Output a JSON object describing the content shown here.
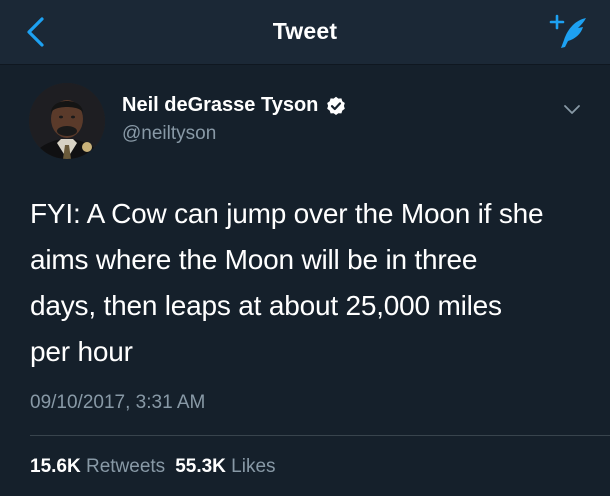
{
  "nav": {
    "title": "Tweet",
    "back_icon": "chevron-left-icon",
    "compose_icon": "compose-tweet-icon",
    "accent_color": "#1da1f2"
  },
  "tweet": {
    "author_name": "Neil deGrasse Tyson",
    "handle": "@neiltyson",
    "verified": true,
    "text": "FYI: A Cow can jump over the Moon if she\naims where the Moon will be in three\ndays, then leaps at about 25,000 miles\nper hour",
    "timestamp": "09/10/2017, 3:31 AM",
    "retweets_count": "15.6K",
    "retweets_label": "Retweets",
    "likes_count": "55.3K",
    "likes_label": "Likes"
  },
  "colors": {
    "background": "#15202b",
    "navbar": "#1b2836",
    "secondary_text": "#8899a6",
    "divider": "#38444d"
  }
}
